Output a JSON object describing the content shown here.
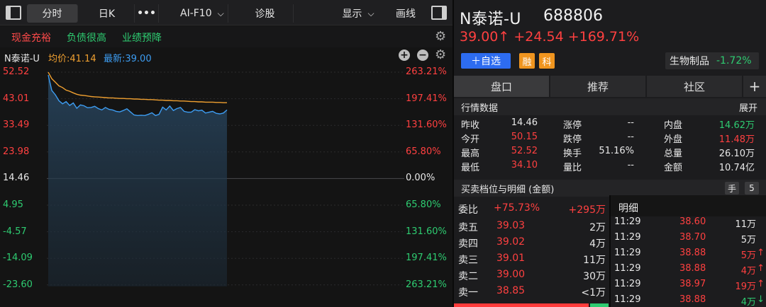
{
  "toolbar": {
    "tabs": [
      "分时",
      "日K",
      "•••",
      "AI-F10",
      "诊股",
      "显示",
      "画线"
    ]
  },
  "tags": [
    "现金充裕",
    "负债很高",
    "业绩预降"
  ],
  "chart_info": {
    "name": "N泰诺-U",
    "avg": "均价:41.14",
    "latest": "最新:39.00"
  },
  "chart_data": {
    "type": "line",
    "left_axis": [
      "52.52",
      "43.01",
      "33.49",
      "23.98",
      "14.46",
      "4.95",
      "-4.57",
      "-14.09",
      "-23.60"
    ],
    "right_axis": [
      "263.21%",
      "197.41%",
      "131.60%",
      "65.80%",
      "0.00%",
      "65.80%",
      "131.60%",
      "197.41%",
      "263.21%"
    ],
    "ylim": [
      -23.6,
      52.52
    ],
    "series": [
      {
        "values": [
          52.5,
          50.2,
          48.9,
          47.6,
          47.0,
          46.1,
          45.7,
          45.1,
          44.6,
          44.3,
          44.2,
          44.0,
          43.8,
          43.7,
          43.6,
          43.5,
          43.4,
          43.3,
          43.3,
          43.2,
          43.1,
          43.1,
          43.0,
          43.0,
          42.9,
          42.9,
          42.8,
          42.8,
          42.7,
          42.7,
          42.6,
          42.5,
          42.5,
          42.4,
          42.4,
          42.3,
          42.3,
          42.2,
          42.2,
          42.1,
          42.0,
          42.0,
          41.9,
          41.9,
          41.8,
          41.8,
          41.8,
          41.7,
          41.7,
          41.6,
          41.6
        ]
      },
      {
        "values": [
          51.5,
          46.0,
          44.4,
          42.3,
          41.2,
          42.0,
          40.6,
          41.5,
          39.6,
          40.8,
          40.5,
          39.8,
          39.9,
          40.3,
          39.5,
          39.0,
          39.9,
          39.2,
          39.0,
          38.5,
          38.3,
          38.8,
          39.4,
          38.3,
          37.2,
          37.0,
          37.1,
          37.0,
          37.4,
          38.0,
          37.0,
          37.4,
          40.0,
          39.0,
          40.4,
          38.8,
          39.5,
          39.9,
          38.5,
          38.2,
          38.2,
          39.1,
          38.7,
          38.9,
          37.9,
          38.2,
          38.5,
          37.8,
          37.6,
          37.9,
          39.0
        ]
      }
    ]
  },
  "header": {
    "name": "N泰诺-U",
    "code": "688806",
    "price": "39.00↑ +24.54 +169.71%",
    "add_btn": "＋自选",
    "badges": [
      "融",
      "科"
    ],
    "sector": "生物制品",
    "sector_change": "-1.72%"
  },
  "tabs": [
    "盘口",
    "推荐",
    "社区",
    "+"
  ],
  "quote": {
    "title": "行情数据",
    "expand": "展开",
    "rows": [
      [
        [
          "昨收",
          "14.46"
        ],
        [
          "涨停",
          "--"
        ],
        [
          "内盘",
          "14.62万"
        ]
      ],
      [
        [
          "今开",
          "50.15"
        ],
        [
          "跌停",
          "--"
        ],
        [
          "外盘",
          "11.48万"
        ]
      ],
      [
        [
          "最高",
          "52.52"
        ],
        [
          "换手",
          "51.16%"
        ],
        [
          "总量",
          "26.10万"
        ]
      ],
      [
        [
          "最低",
          "34.10"
        ],
        [
          "量比",
          "--"
        ],
        [
          "金额",
          "10.74亿"
        ]
      ]
    ]
  },
  "orderbook": {
    "title": "买卖档位与明细 (金额)",
    "hand_badge": "手",
    "five_badge": "5",
    "weibi_label": "委比",
    "weibi_pct": "+75.73%",
    "weibi_amt": "+295万",
    "detail_label": "明细",
    "asks": [
      {
        "label": "卖五",
        "price": "39.03",
        "vol": "2万"
      },
      {
        "label": "卖四",
        "price": "39.02",
        "vol": "4万"
      },
      {
        "label": "卖三",
        "price": "39.01",
        "vol": "11万"
      },
      {
        "label": "卖二",
        "price": "39.00",
        "vol": "30万"
      },
      {
        "label": "卖一",
        "price": "38.85",
        "vol": "<1万"
      }
    ],
    "trades": [
      {
        "time": "11:29",
        "price": "38.60",
        "vol": "11万",
        "dir": ""
      },
      {
        "time": "11:29",
        "price": "38.70",
        "vol": "5万",
        "dir": ""
      },
      {
        "time": "11:29",
        "price": "38.88",
        "vol": "5万",
        "dir": "↑"
      },
      {
        "time": "11:29",
        "price": "38.88",
        "vol": "4万",
        "dir": "↑"
      },
      {
        "time": "11:29",
        "price": "38.97",
        "vol": "19万",
        "dir": "↑"
      },
      {
        "time": "11:29",
        "price": "38.88",
        "vol": "4万",
        "dir": "↓"
      }
    ]
  },
  "colors": {
    "up": "#ff4040",
    "down": "#2ecc71",
    "price_line": "#3d9df2",
    "avg_line": "#f0a030",
    "accent": "#2d6cf0"
  }
}
